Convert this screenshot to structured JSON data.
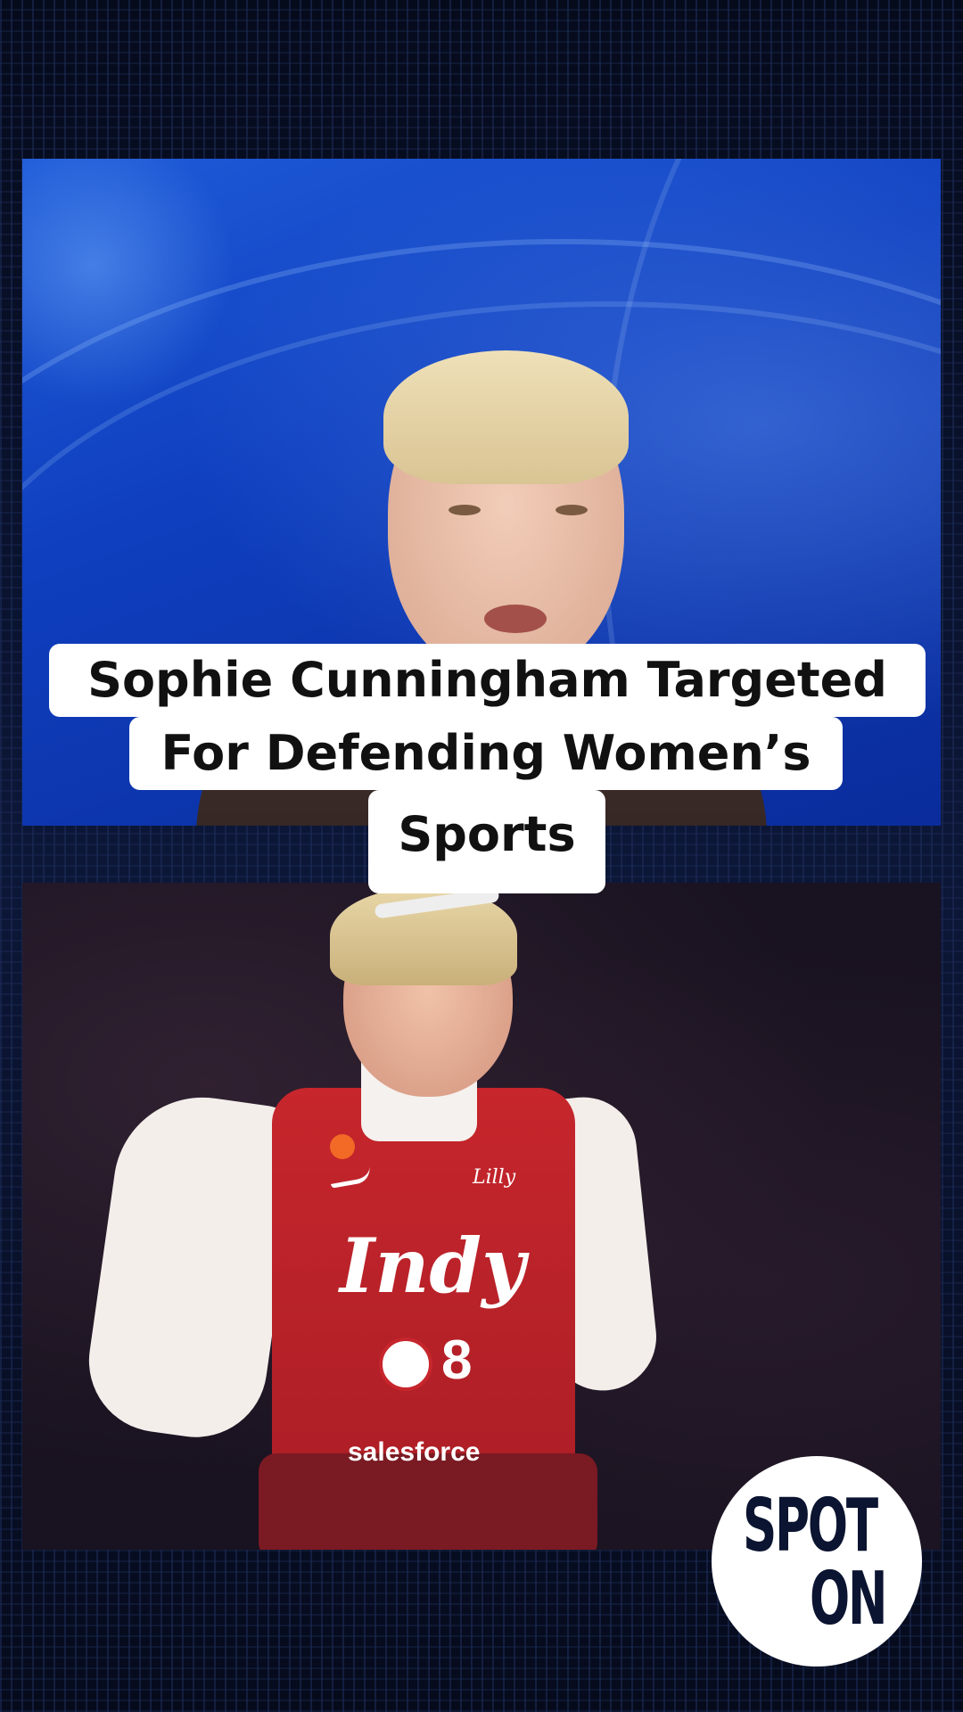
{
  "headline": {
    "line1": "Sophie Cunningham Targeted",
    "line2": "For Defending Women’s",
    "line3": "Sports"
  },
  "jersey": {
    "team_script": "Indy",
    "number": "8",
    "sponsor": "salesforce",
    "brand": "Lilly"
  },
  "logo": {
    "line1": "SPOT",
    "line2": "ON"
  },
  "colors": {
    "background": "#0a1330",
    "studio_blue": "#1f5bd8",
    "jersey_red": "#c6262c",
    "caption_bg": "#ffffff",
    "logo_text": "#0b1430"
  }
}
